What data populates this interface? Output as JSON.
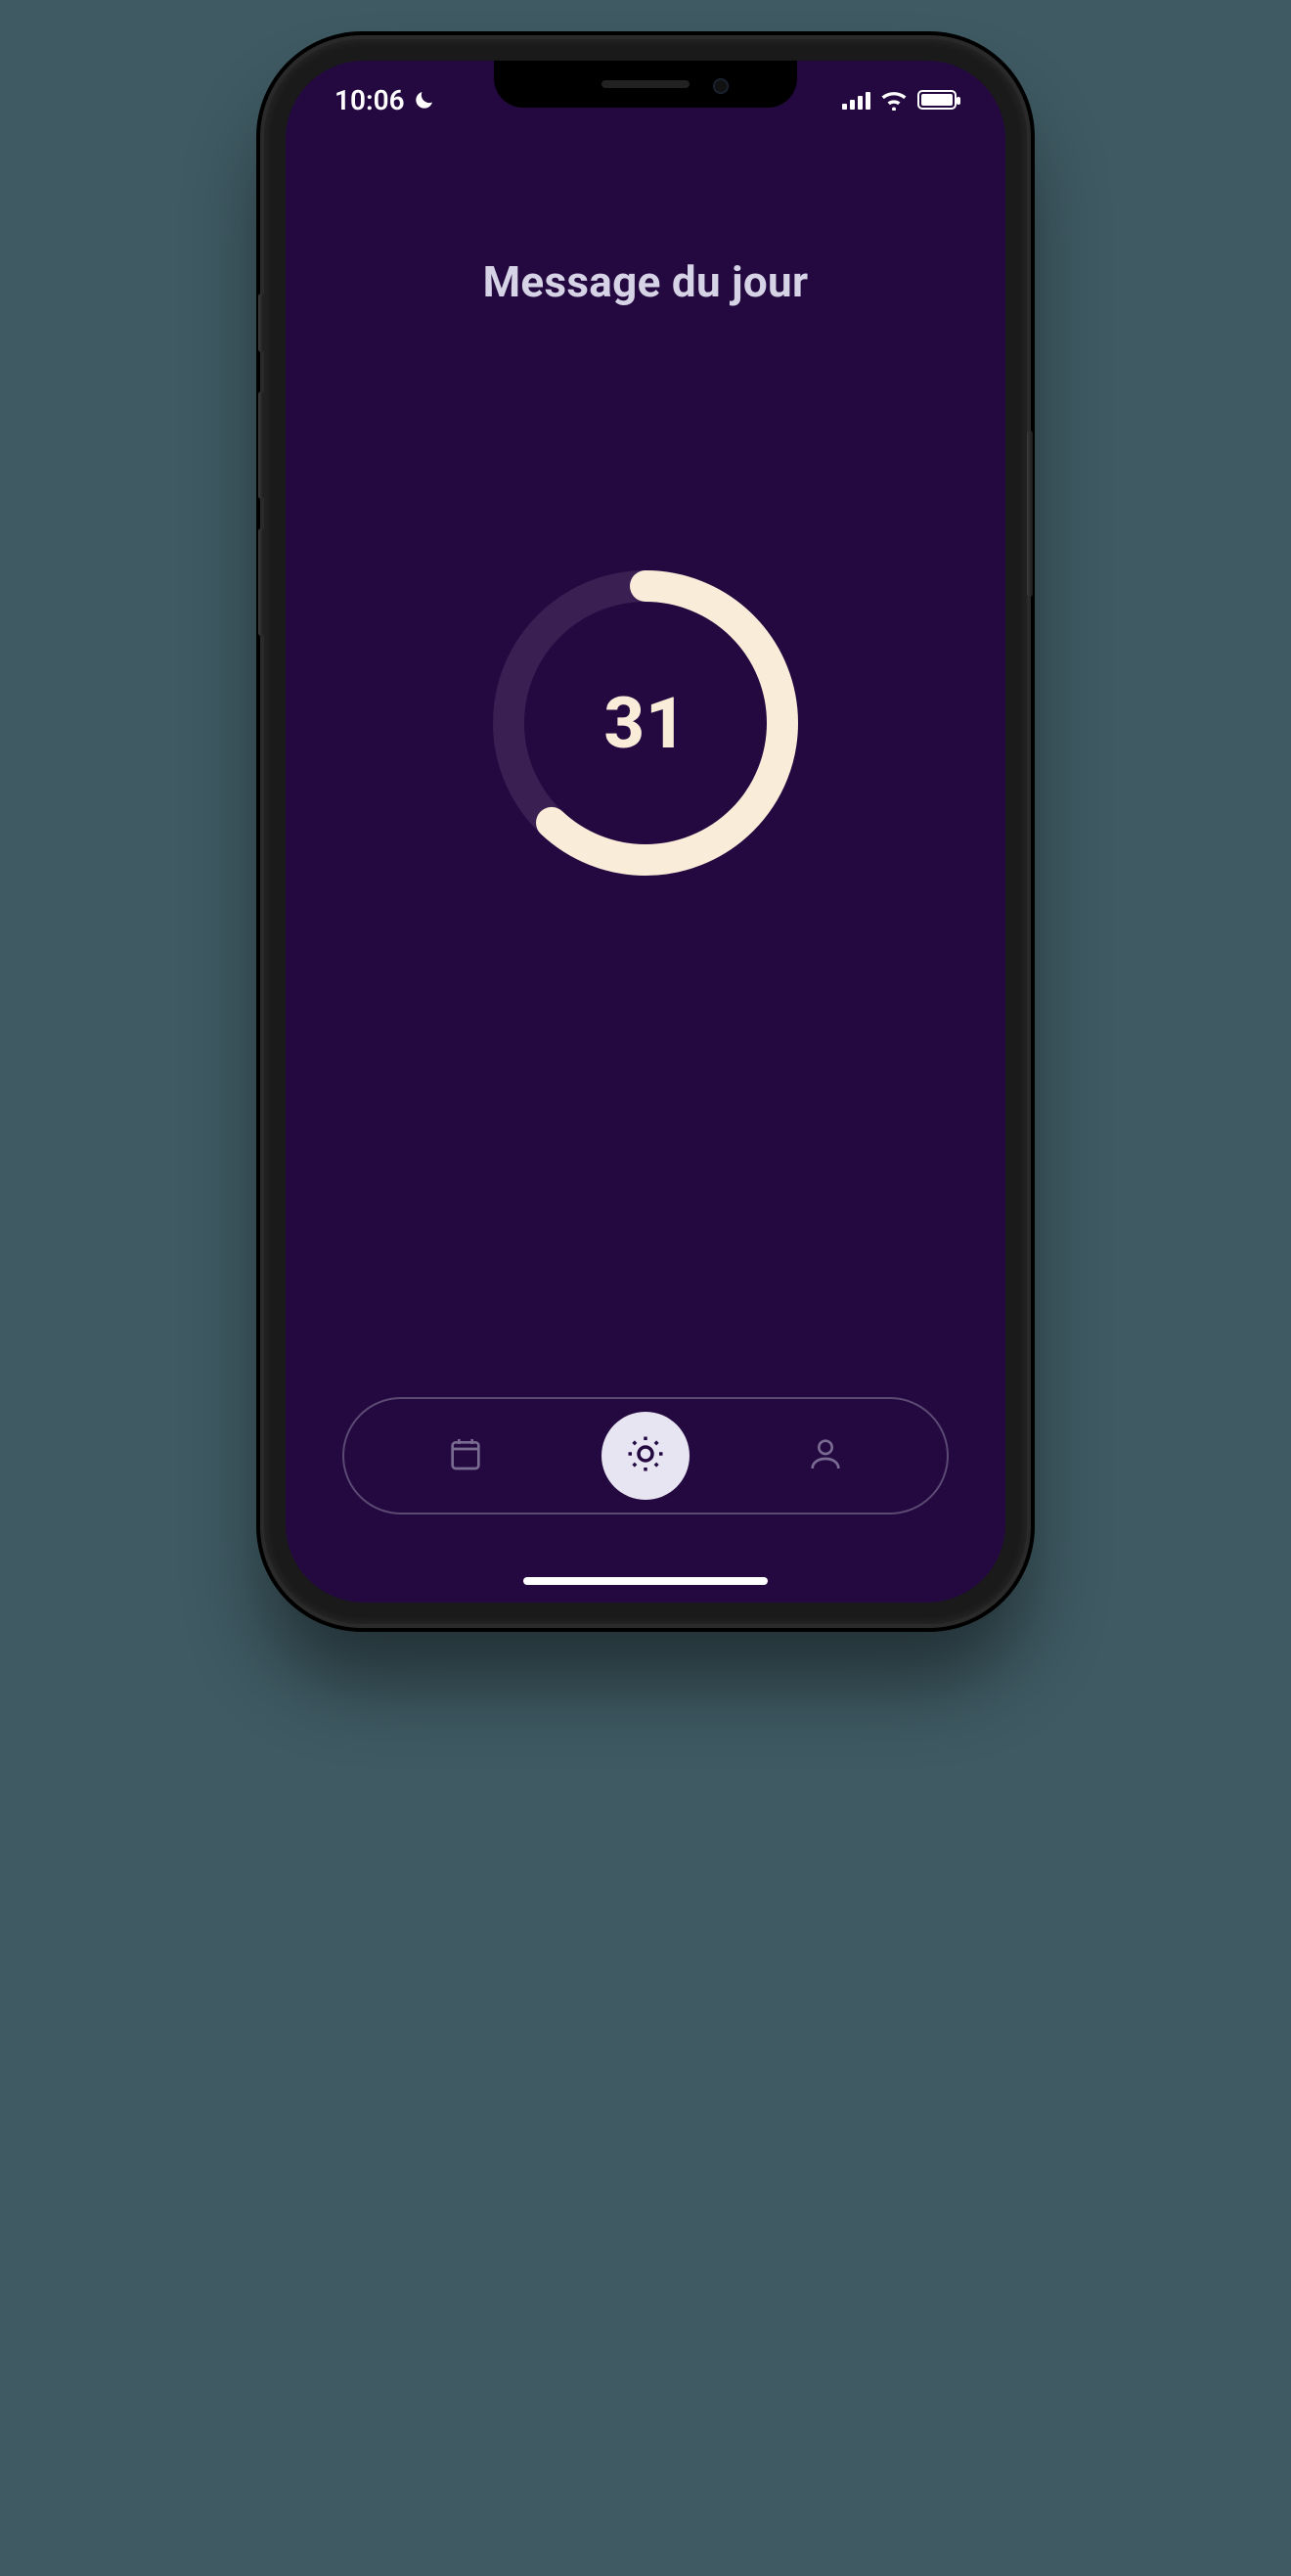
{
  "status": {
    "time": "10:06",
    "dnd_icon": "moon-icon",
    "signal_icon": "cellular-signal-icon",
    "wifi_icon": "wifi-icon",
    "battery_icon": "battery-icon"
  },
  "page": {
    "title": "Message du jour"
  },
  "progress": {
    "value": "31",
    "percent": 62,
    "track_color": "#3a1f53",
    "fill_color": "#f9ecd9"
  },
  "nav": {
    "items": [
      {
        "name": "calendar-tab",
        "icon": "calendar-icon",
        "active": false
      },
      {
        "name": "today-tab",
        "icon": "sun-icon",
        "active": true
      },
      {
        "name": "profile-tab",
        "icon": "person-icon",
        "active": false
      }
    ]
  },
  "colors": {
    "background": "#23093f",
    "accent": "#f9ecd9",
    "nav_border": "#5b4a73",
    "inactive_icon": "#7a6b92"
  }
}
